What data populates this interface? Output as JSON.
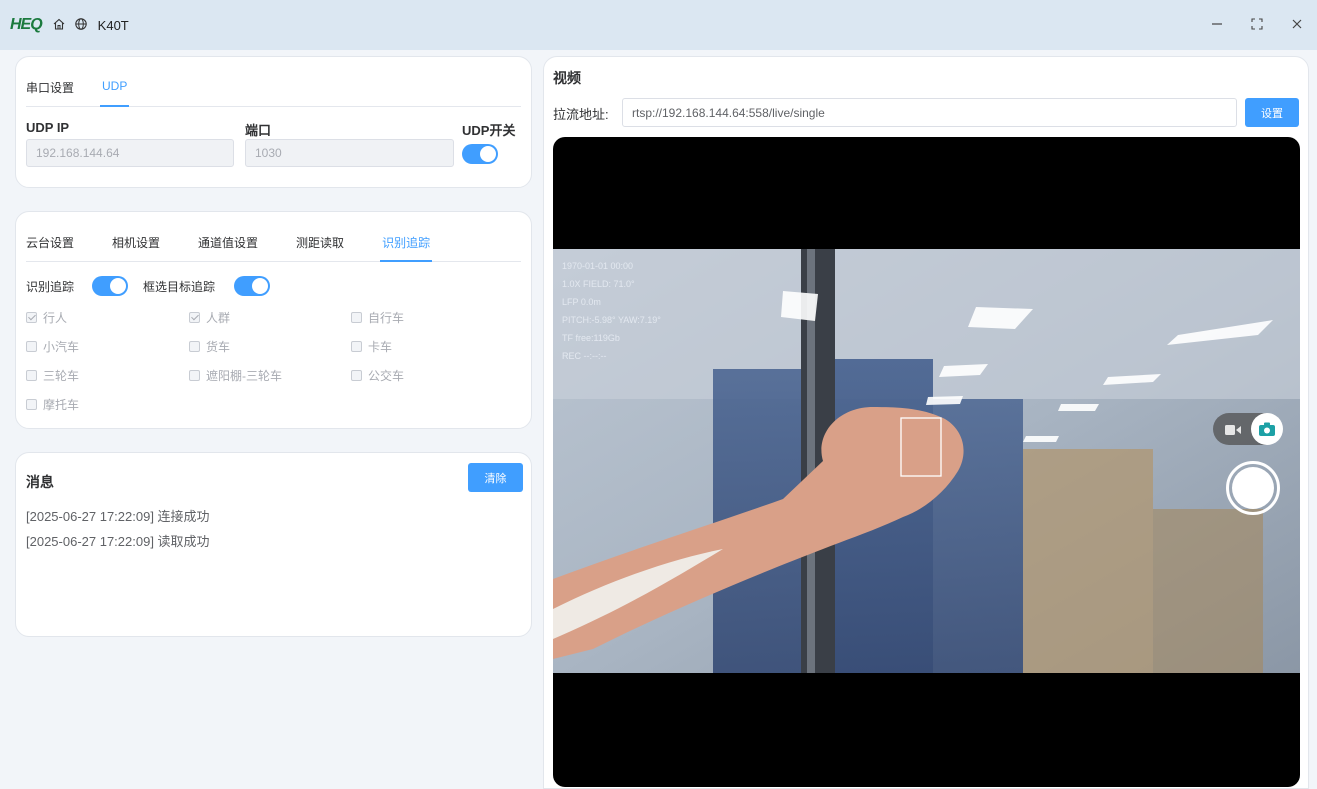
{
  "titlebar": {
    "logo": "HEQ",
    "title": "K40T",
    "icons": [
      "home-icon",
      "globe-icon"
    ],
    "controls": [
      "minimize-icon",
      "maximize-icon",
      "close-icon"
    ]
  },
  "udp_card": {
    "tabs": [
      {
        "label": "串口设置",
        "active": false
      },
      {
        "label": "UDP",
        "active": true
      }
    ],
    "ip_label": "UDP IP",
    "ip_value": "192.168.144.64",
    "port_label": "端口",
    "port_value": "1030",
    "switch_label": "UDP开关",
    "switch_on": true
  },
  "tracking_card": {
    "tabs": [
      {
        "label": "云台设置",
        "active": false
      },
      {
        "label": "相机设置",
        "active": false
      },
      {
        "label": "通道值设置",
        "active": false
      },
      {
        "label": "测距读取",
        "active": false
      },
      {
        "label": "识别追踪",
        "active": true
      }
    ],
    "toggle1_label": "识别追踪",
    "toggle1_on": true,
    "toggle2_label": "框选目标追踪",
    "toggle2_on": true,
    "checkboxes": [
      {
        "label": "行人",
        "checked": true
      },
      {
        "label": "人群",
        "checked": true
      },
      {
        "label": "自行车",
        "checked": false
      },
      {
        "label": "小汽车",
        "checked": false
      },
      {
        "label": "货车",
        "checked": false
      },
      {
        "label": "卡车",
        "checked": false
      },
      {
        "label": "三轮车",
        "checked": false
      },
      {
        "label": "遮阳棚-三轮车",
        "checked": false
      },
      {
        "label": "公交车",
        "checked": false
      },
      {
        "label": "摩托车",
        "checked": false
      }
    ]
  },
  "message_card": {
    "title": "消息",
    "clear_label": "清除",
    "messages": [
      "[2025-06-27 17:22:09] 连接成功",
      "[2025-06-27 17:22:09] 读取成功"
    ]
  },
  "video_panel": {
    "title": "视频",
    "stream_label": "拉流地址:",
    "stream_url": "rtsp://192.168.144.64:558/live/single",
    "set_label": "设置",
    "osd": [
      "1970-01-01 00:00",
      "1.0X FIELD: 71.0°",
      "LFP 0.0m",
      "PITCH:-5.98° YAW:7.19°",
      "TF free:119Gb",
      "REC --:--:--"
    ],
    "mode_icons": [
      "video-icon",
      "camera-icon"
    ],
    "shutter": "shutter-button"
  },
  "colors": {
    "accent": "#409eff",
    "titlebar_bg": "#dbe7f2",
    "page_bg": "#f2f5f9",
    "logo": "#1b7a3e"
  }
}
